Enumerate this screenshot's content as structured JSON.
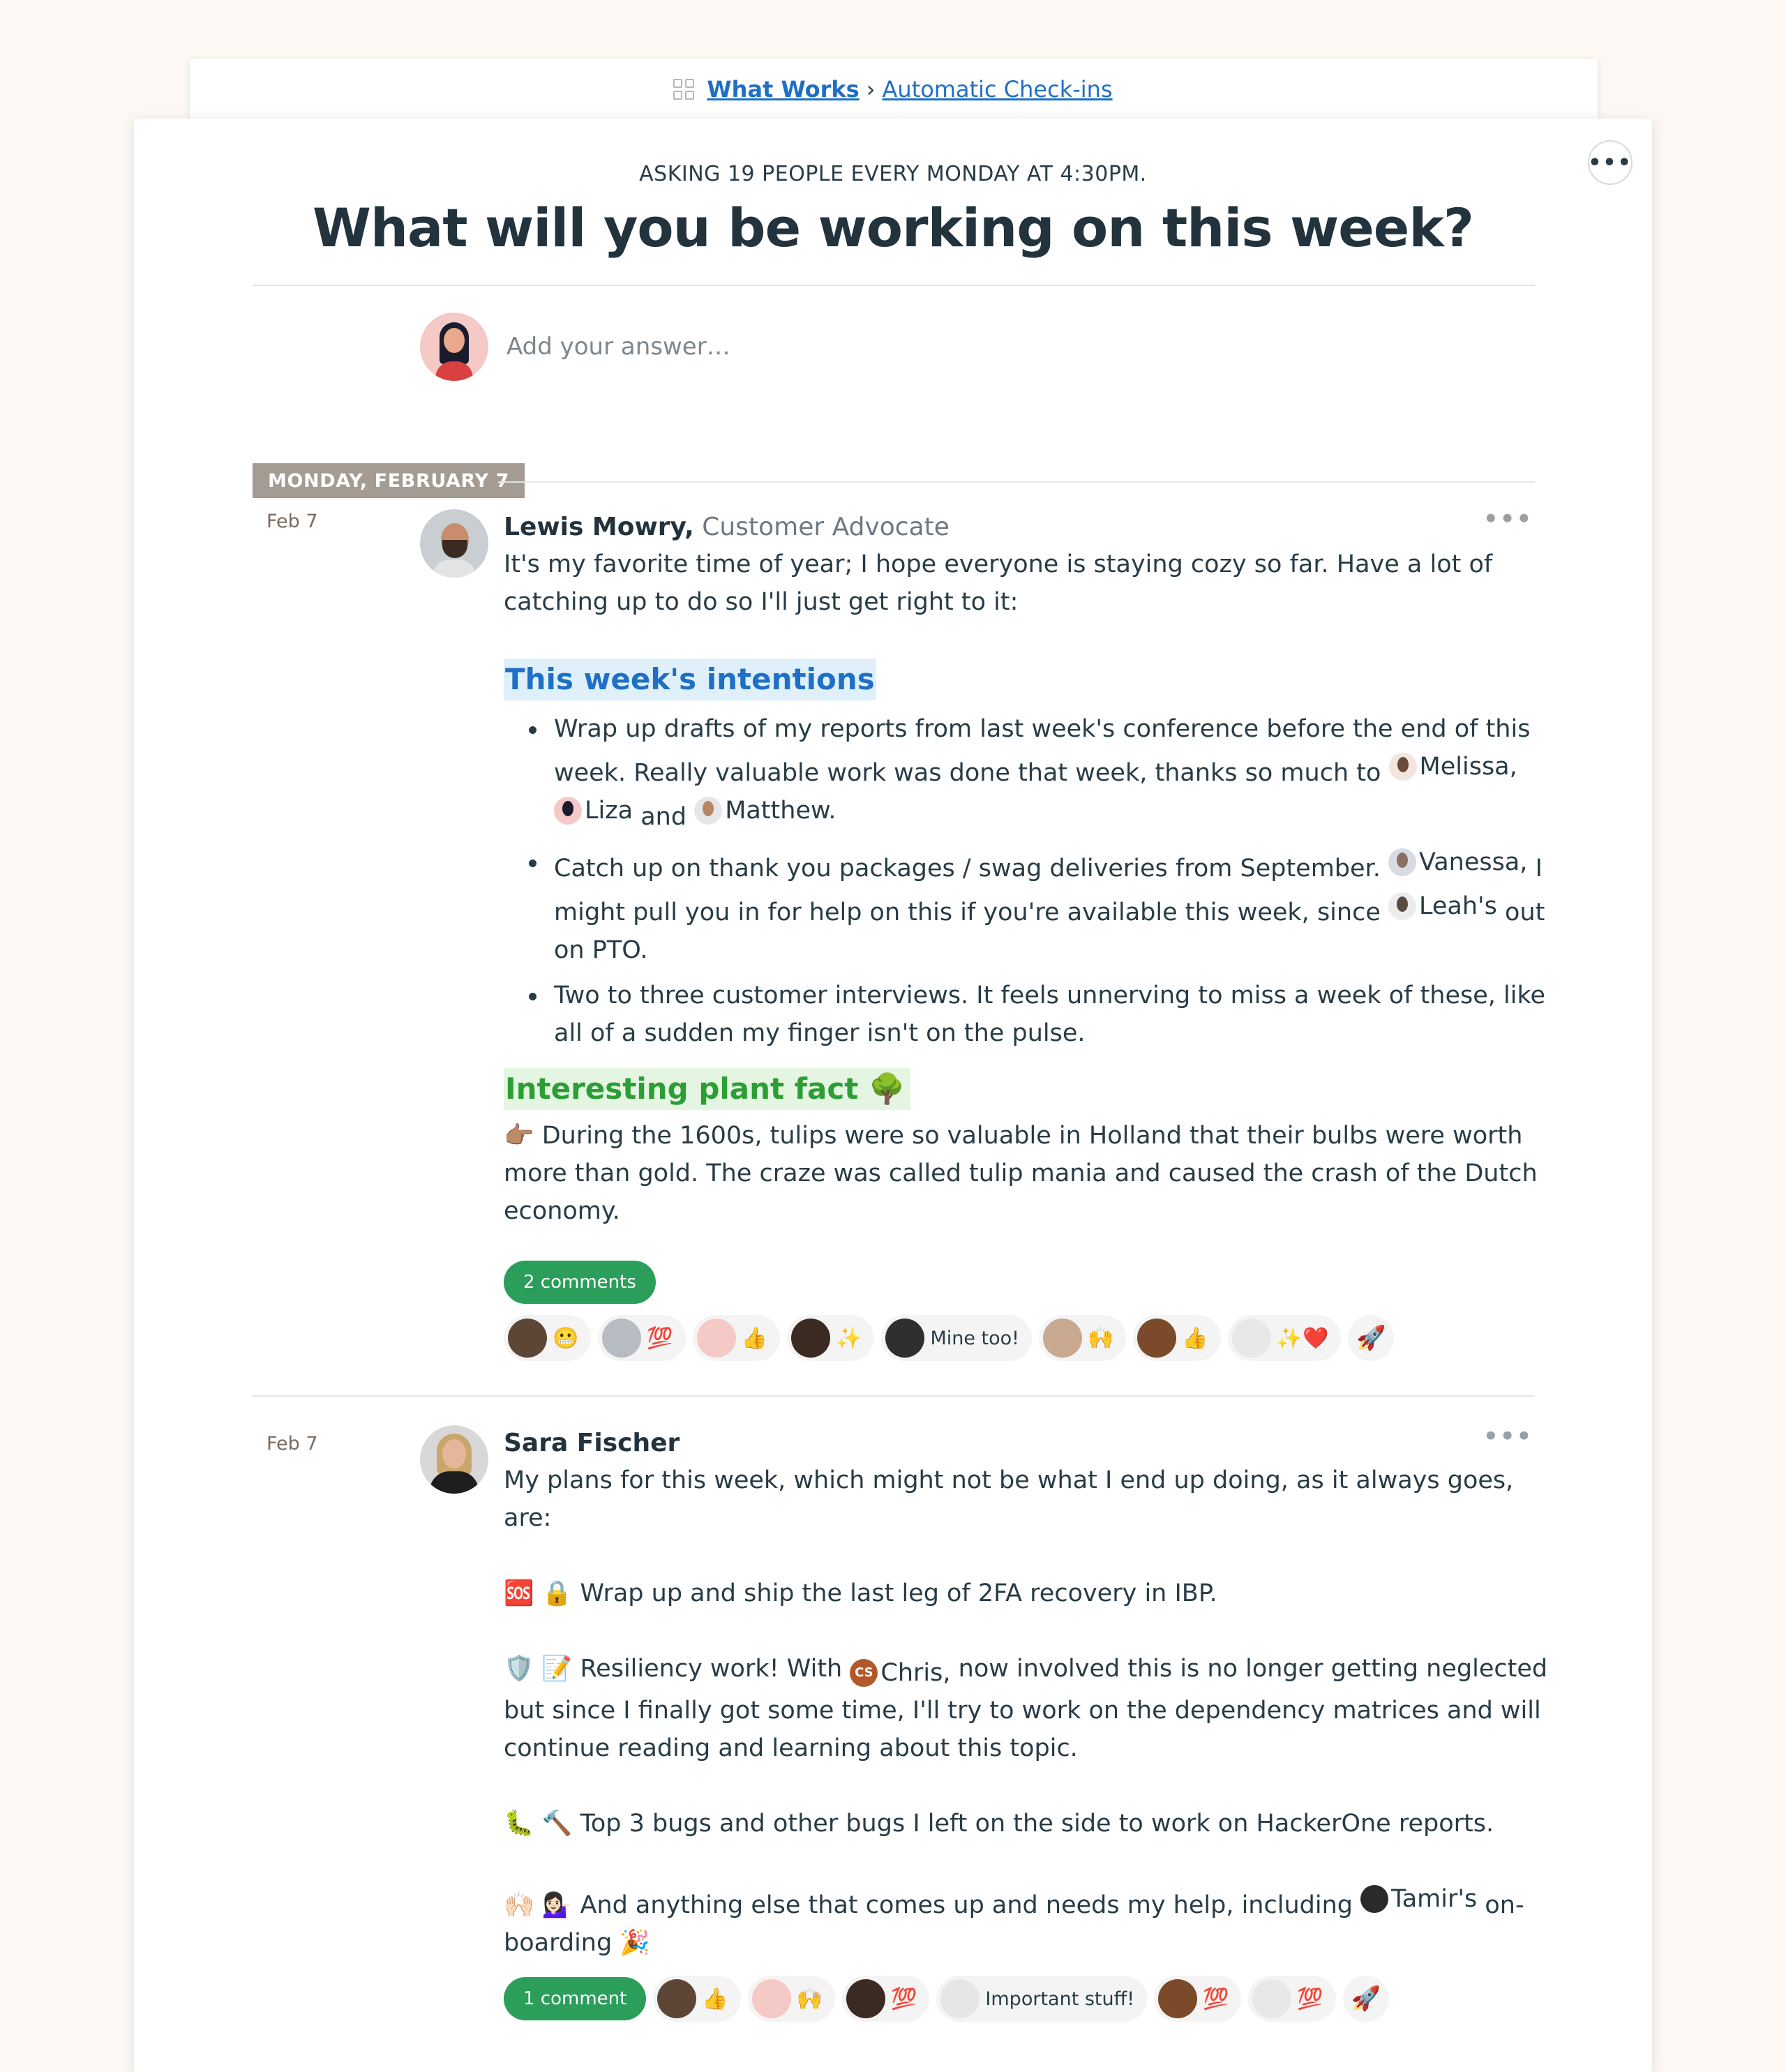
{
  "breadcrumb": {
    "project": "What Works",
    "separator": "›",
    "tool": "Automatic Check-ins"
  },
  "checkin": {
    "kicker": "ASKING 19 PEOPLE EVERY MONDAY AT 4:30PM.",
    "question": "What will you be working on this week?",
    "answer_placeholder": "Add your answer…"
  },
  "day_label": "MONDAY, FEBRUARY 7",
  "posts": [
    {
      "date": "Feb 7",
      "author": "Lewis Mowry,",
      "role": "Customer Advocate",
      "intro_1": "It's my favorite time of year; I hope everyone is staying cozy so far. Have a lot of catching up to do so I'll just get right to it:",
      "heading_1": "This week's intentions",
      "bullet_1a": "Wrap up drafts of my reports from last week's conference before the end of this week. Really valuable work was done that week, thanks so much to",
      "mention_melissa": "Melissa,",
      "mention_liza": "Liza",
      "and": "and",
      "mention_matthew": "Matthew.",
      "bullet_2a": "Catch up on thank you packages / swag deliveries from September.",
      "mention_vanessa": "Vanessa,",
      "bullet_2b": "I might pull you in for help on this if you're available this week, since",
      "mention_leah": "Leah's",
      "bullet_2c": "out on PTO.",
      "bullet_3": "Two to three customer interviews. It feels unnerving to miss a week of these, like all of a sudden my finger isn't on the pulse.",
      "heading_2": "Interesting plant fact",
      "heading_2_emoji": "🌳",
      "fact_emoji": "👉🏽",
      "fact": "During the 1600s, tulips were so valuable in Holland that their bulbs were worth more than gold. The craze was called tulip mania and caused the crash of the Dutch economy.",
      "comments": "2 comments",
      "boosts": [
        "😬",
        "💯",
        "👍",
        "✨",
        "Mine too!",
        "🙌",
        "👍",
        "✨❤️"
      ]
    },
    {
      "date": "Feb 7",
      "author": "Sara Fischer",
      "line_1": "My plans for this week, which might not be what I end up doing, as it always goes, are:",
      "line_2_emoji": "🆘 🔒",
      "line_2": "Wrap up and ship the last leg of 2FA recovery in IBP.",
      "line_3_emoji": "🛡️ 📝",
      "line_3a": "Resiliency work! With",
      "cs_initials": "CS",
      "mention_chris": "Chris,",
      "line_3b": "now involved this is no longer getting neglected but since I finally got some time, I'll try to work on the dependency matrices and will continue reading and learning about this topic.",
      "line_4_emoji": "🐛 🔨",
      "line_4": "Top 3 bugs and other bugs I left on the side to work on HackerOne reports.",
      "line_5_emoji": "🙌🏻 💁🏻‍♀️",
      "line_5a": "And anything else that comes up and needs my help, including",
      "mention_tamir": "Tamir's",
      "line_5b": "on-boarding",
      "line_5_end": "🎉",
      "comments": "1 comment",
      "boosts": [
        "👍",
        "🙌",
        "💯",
        "Important stuff!",
        "💯",
        "💯"
      ]
    }
  ],
  "icons": {
    "more": "•••",
    "boost_add": "rocket-plus-icon"
  },
  "colors": {
    "link": "#1f6fc5",
    "heading_blue_bg": "#dff0fa",
    "heading_green": "#2b9e34",
    "comments_pill": "#2b9e5b",
    "day_pill": "#a49b92",
    "page_bg": "#fdf8f3"
  }
}
